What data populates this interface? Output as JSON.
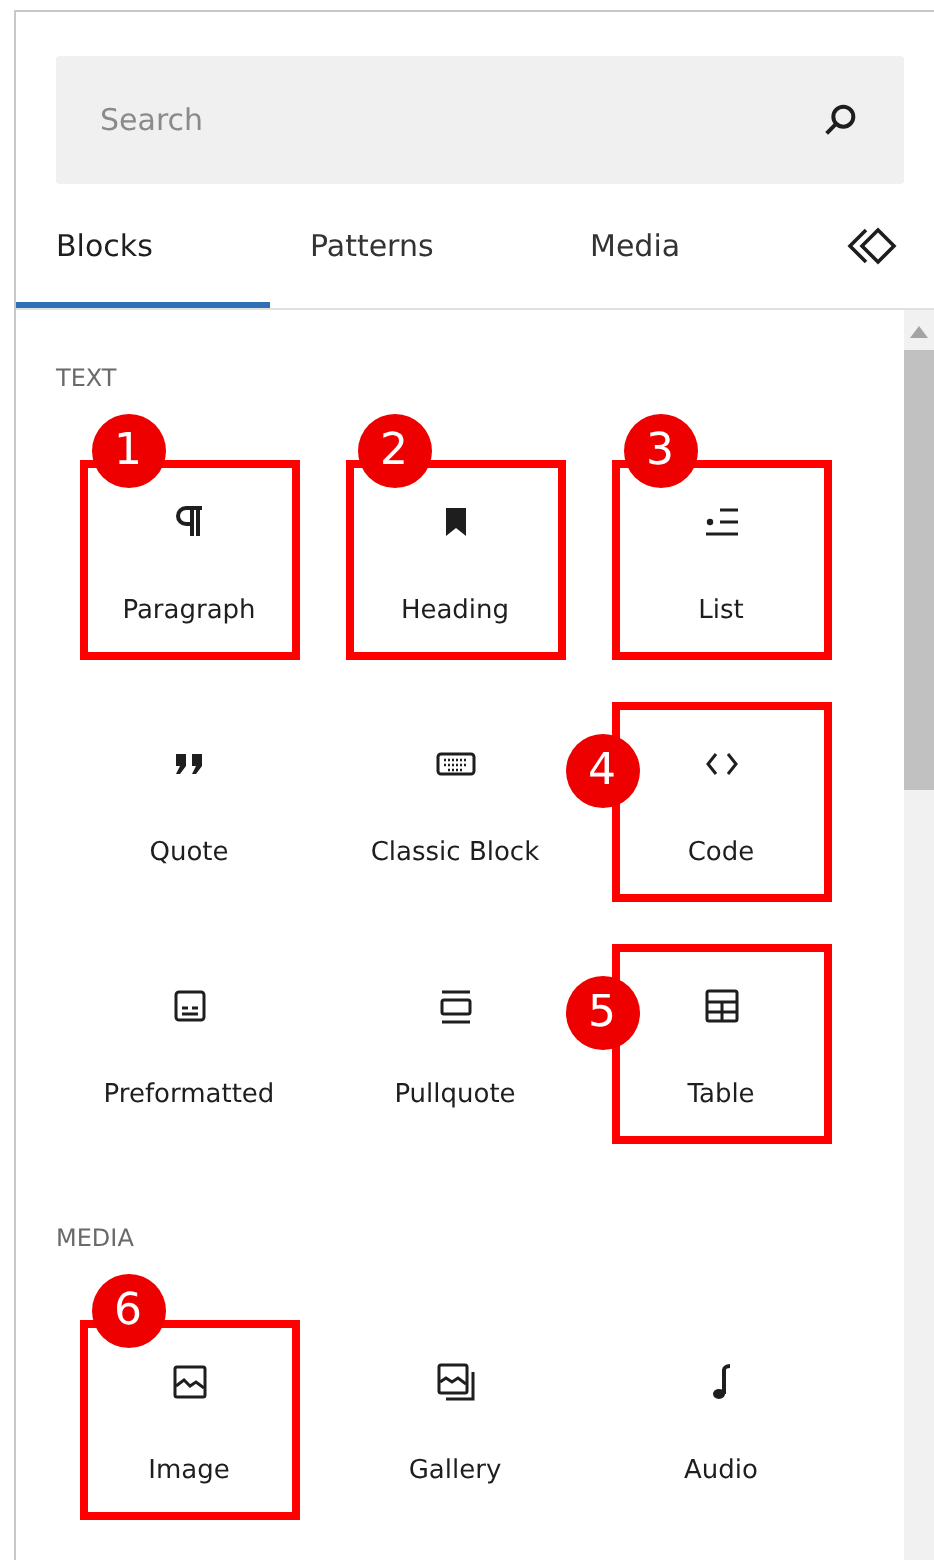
{
  "search": {
    "placeholder": "Search"
  },
  "tabs": [
    {
      "label": "Blocks",
      "selected": true
    },
    {
      "label": "Patterns",
      "selected": false
    },
    {
      "label": "Media",
      "selected": false
    }
  ],
  "sections": [
    {
      "title": "TEXT",
      "items": [
        {
          "label": "Paragraph",
          "highlighted": true,
          "badge": "1"
        },
        {
          "label": "Heading",
          "highlighted": true,
          "badge": "2"
        },
        {
          "label": "List",
          "highlighted": true,
          "badge": "3"
        },
        {
          "label": "Quote",
          "highlighted": false
        },
        {
          "label": "Classic Block",
          "highlighted": false
        },
        {
          "label": "Code",
          "highlighted": true,
          "badge": "4"
        },
        {
          "label": "Preformatted",
          "highlighted": false
        },
        {
          "label": "Pullquote",
          "highlighted": false
        },
        {
          "label": "Table",
          "highlighted": true,
          "badge": "5"
        }
      ]
    },
    {
      "title": "MEDIA",
      "items": [
        {
          "label": "Image",
          "highlighted": true,
          "badge": "6"
        },
        {
          "label": "Gallery",
          "highlighted": false
        },
        {
          "label": "Audio",
          "highlighted": false
        }
      ]
    }
  ]
}
